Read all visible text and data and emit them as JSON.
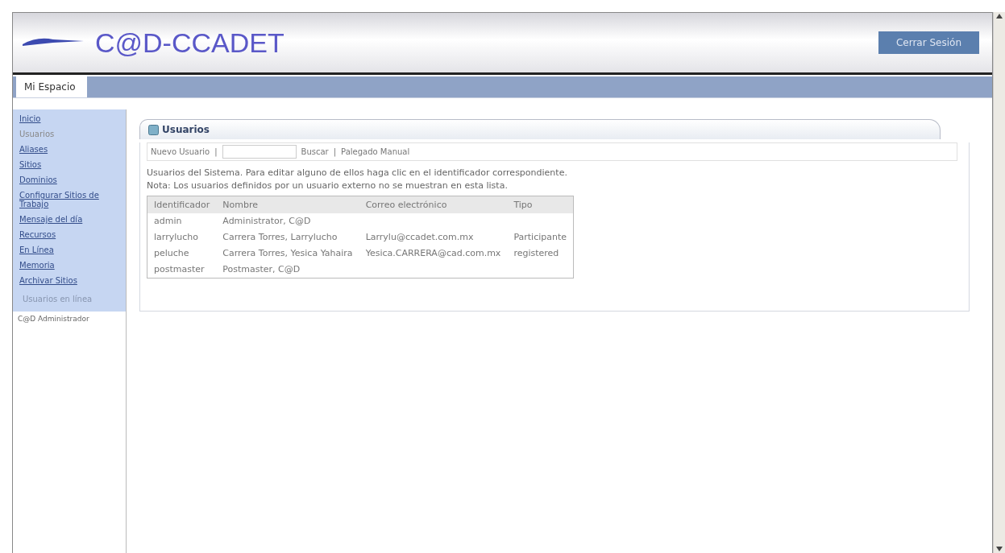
{
  "header": {
    "site_title": "C@D-CCADET",
    "logout_button": "Cerrar Sesión"
  },
  "tabs": [
    {
      "label": "Mi Espacio",
      "selected": true
    }
  ],
  "sidebar": {
    "items": [
      {
        "label": "Inicio",
        "selected": false
      },
      {
        "label": "Usuarios",
        "selected": true
      },
      {
        "label": "Aliases",
        "selected": false
      },
      {
        "label": "Sitios",
        "selected": false
      },
      {
        "label": "Dominios",
        "selected": false
      },
      {
        "label": "Configurar Sitios de Trabajo",
        "selected": false
      },
      {
        "label": "Mensaje del día",
        "selected": false
      },
      {
        "label": "Recursos",
        "selected": false
      },
      {
        "label": "En Línea",
        "selected": false
      },
      {
        "label": "Memoria",
        "selected": false
      },
      {
        "label": "Archivar Sitios",
        "selected": false
      }
    ],
    "online_heading": "Usuarios en línea",
    "online_users": [
      "C@D Administrador"
    ]
  },
  "panel": {
    "title": "Usuarios",
    "toolbar": [
      {
        "kind": "link",
        "label": "Nuevo Usuario"
      },
      {
        "kind": "separator",
        "label": "|"
      },
      {
        "kind": "field"
      },
      {
        "kind": "link",
        "label": "Buscar"
      },
      {
        "kind": "separator",
        "label": "|"
      },
      {
        "kind": "link",
        "label": "Palegado Manual"
      }
    ],
    "instructions": [
      "Usuarios del Sistema. Para editar alguno de ellos haga clic en el identificador correspondiente.",
      "Nota: Los usuarios definidos por un usuario externo no se muestran en esta lista."
    ],
    "table": {
      "columns": [
        "Identificador",
        "Nombre",
        "Correo electrónico",
        "Tipo"
      ],
      "rows": [
        [
          "admin",
          "Administrator, C@D",
          "",
          ""
        ],
        [
          "larrylucho",
          "Carrera Torres, Larrylucho",
          "Larrylu@ccadet.com.mx",
          "Participante"
        ],
        [
          "peluche",
          "Carrera Torres, Yesica Yahaira",
          "Yesica.CARRERA@cad.com.mx",
          "registered"
        ],
        [
          "postmaster",
          "Postmaster, C@D",
          "",
          ""
        ]
      ]
    }
  }
}
